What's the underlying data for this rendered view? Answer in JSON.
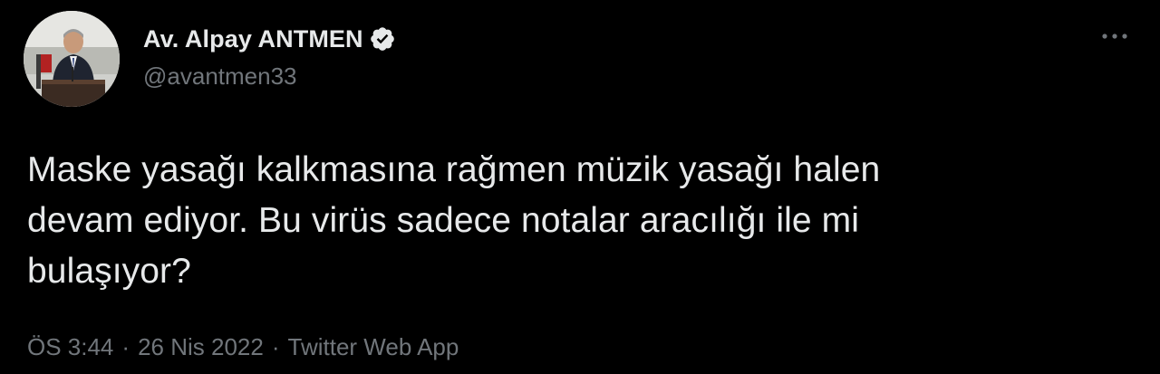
{
  "author": {
    "display_name": "Av. Alpay ANTMEN",
    "handle": "@avantmen33",
    "verified": true
  },
  "tweet": {
    "line1": "Maske yasağı kalkmasına rağmen müzik yasağı halen",
    "line2": "devam ediyor. Bu virüs sadece notalar aracılığı ile mi",
    "line3": "bulaşıyor?"
  },
  "meta": {
    "time": "ÖS 3:44",
    "separator": "·",
    "date": "26 Nis 2022",
    "source": "Twitter Web App"
  },
  "icons": {
    "more": "more-horizontal-icon",
    "verified": "verified-badge-icon"
  },
  "colors": {
    "background": "#000000",
    "primary_text": "#e7e9ea",
    "secondary_text": "#71767b",
    "verified_badge": "#e7e9ea"
  }
}
